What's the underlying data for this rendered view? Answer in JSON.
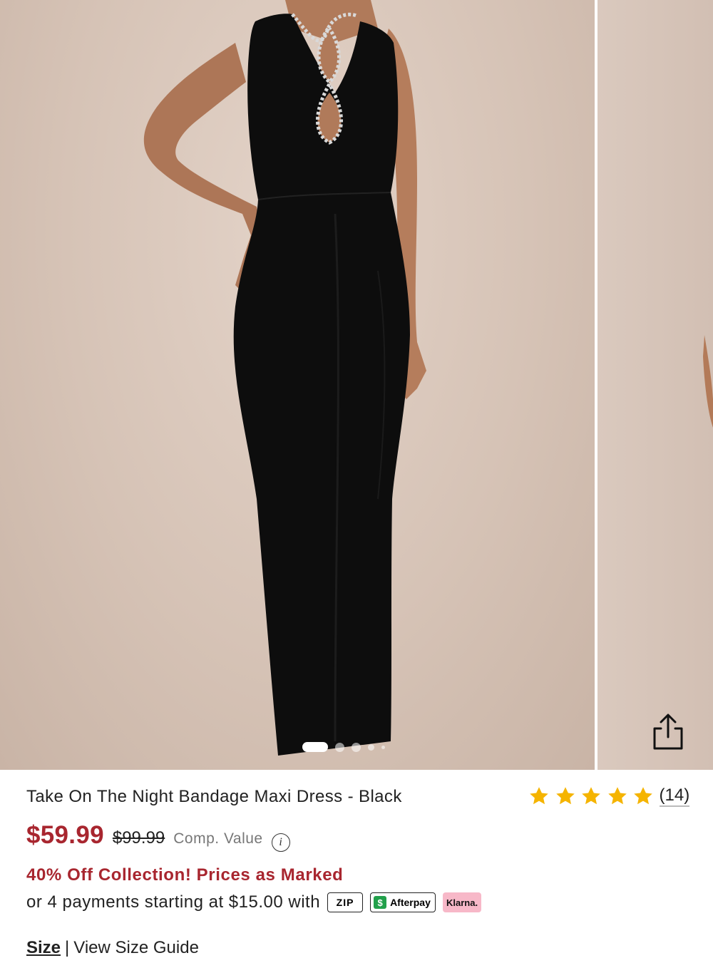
{
  "product": {
    "title": "Take On The Night Bandage Maxi Dress - Black",
    "rating": 5,
    "review_count": "(14)",
    "sale_price": "$59.99",
    "original_price": "$99.99",
    "comp_value_label": "Comp. Value",
    "info_glyph": "i",
    "promo": "40% Off Collection! Prices as Marked",
    "payments_text": "or 4 payments starting at $15.00 with",
    "payment_providers": {
      "zip": "ZIP",
      "afterpay": "Afterpay",
      "afterpay_glyph": "$",
      "klarna": "Klarna."
    }
  },
  "gallery": {
    "active_index": 0,
    "dot_count": 5
  },
  "size": {
    "label": "Size",
    "separator": "|",
    "guide_link": "View Size Guide"
  },
  "colors": {
    "sale_red": "#a8262f",
    "star_gold": "#f5b400",
    "photo_bg": "#d6c3b6",
    "dress": "#0d0d0d"
  },
  "icons": [
    "share-icon",
    "star-icon",
    "info-icon",
    "afterpay-icon"
  ]
}
